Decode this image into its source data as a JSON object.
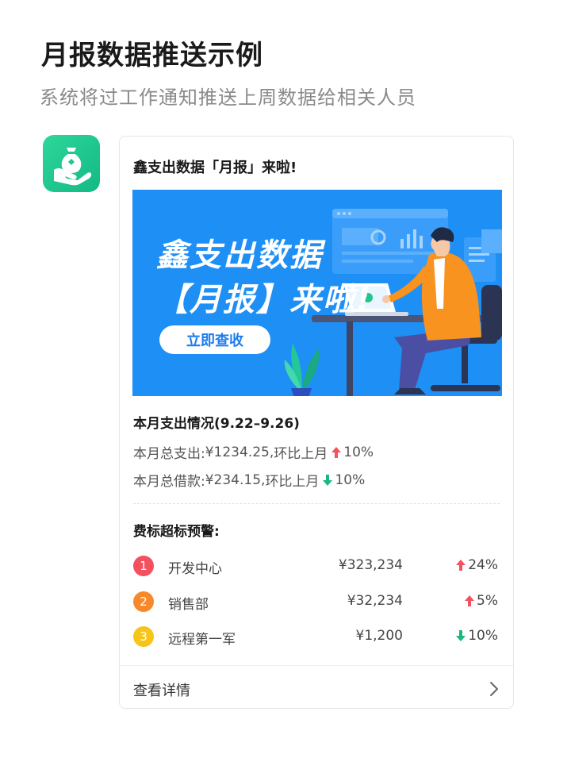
{
  "header": {
    "title": "月报数据推送示例",
    "subtitle": "系统将过工作通知推送上周数据给相关人员"
  },
  "app": {
    "icon": "money-bag-hand-icon",
    "color": "#1fc78e"
  },
  "card": {
    "title": "鑫支出数据「月报」来啦!",
    "banner": {
      "line1": "鑫支出数据",
      "line2": "【月报】来啦!",
      "button": "立即查收",
      "bg_color": "#1e8ff5"
    },
    "summary": {
      "title": "本月支出情况(9.22–9.26)",
      "rows": [
        {
          "label": "本月总支出:",
          "amount": "¥1234.25,",
          "compare": "环比上月",
          "direction": "up",
          "pct": "10%"
        },
        {
          "label": "本月总借款:",
          "amount": "¥234.15,",
          "compare": "环比上月",
          "direction": "down",
          "pct": "10%"
        }
      ]
    },
    "warnings": {
      "title": "费标超标预警:",
      "items": [
        {
          "rank": "1",
          "dept": "开发中心",
          "amount": "¥323,234",
          "direction": "up",
          "pct": "24%",
          "color": "#f5505d"
        },
        {
          "rank": "2",
          "dept": "销售部",
          "amount": "¥32,234",
          "direction": "up",
          "pct": "5%",
          "color": "#f7892c"
        },
        {
          "rank": "3",
          "dept": "远程第一军",
          "amount": "¥1,200",
          "direction": "down",
          "pct": "10%",
          "color": "#f7c51a"
        }
      ]
    },
    "footer": {
      "link": "查看详情"
    }
  },
  "colors": {
    "up": "#f5505d",
    "down": "#19b87c"
  }
}
